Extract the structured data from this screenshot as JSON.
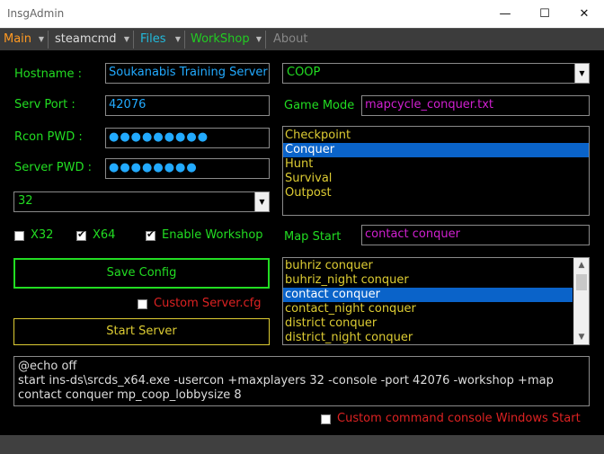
{
  "window": {
    "title": "InsgAdmin",
    "minimize": "—",
    "maximize": "☐",
    "close": "✕"
  },
  "menu": [
    {
      "label": "Main",
      "color": "#ff9922",
      "arrow": true
    },
    {
      "label": "steamcmd",
      "color": "#dddddd",
      "arrow": true
    },
    {
      "label": "Files",
      "color": "#22bbdd",
      "arrow": true
    },
    {
      "label": "WorkShop",
      "color": "#22cc22",
      "arrow": true
    },
    {
      "label": "About",
      "color": "#888888",
      "arrow": false
    }
  ],
  "labels": {
    "hostname": "Hostname :",
    "serv_port": "Serv Port :",
    "rcon_pwd": "Rcon PWD :",
    "server_pwd": "Server PWD :",
    "game_mode": "Game Mode",
    "map_start": "Map Start"
  },
  "fields": {
    "hostname": "Soukanabis Training Server",
    "serv_port": "42076",
    "rcon_pwd": "●●●●●●●●●",
    "server_pwd": "●●●●●●●●",
    "mapcycle": "mapcycle_conquer.txt",
    "map_start": "contact conquer"
  },
  "combos": {
    "game_type": "COOP",
    "max_players": "32"
  },
  "game_modes": [
    "Checkpoint",
    "Conquer",
    "Hunt",
    "Survival",
    "Outpost"
  ],
  "game_mode_selected": "Conquer",
  "maps": [
    "buhriz conquer",
    "buhriz_night conquer",
    "contact conquer",
    "contact_night conquer",
    "district conquer",
    "district_night conquer"
  ],
  "map_selected": "contact conquer",
  "checkboxes": {
    "x32": {
      "label": "X32",
      "checked": false
    },
    "x64": {
      "label": "X64",
      "checked": true
    },
    "enable_workshop": {
      "label": "Enable Workshop",
      "checked": true
    },
    "custom_server_cfg": {
      "label": "Custom Server.cfg",
      "checked": false
    },
    "custom_console": {
      "label": "Custom command console Windows Start",
      "checked": false
    }
  },
  "buttons": {
    "save_config": "Save Config",
    "start_server": "Start Server"
  },
  "console_text": "@echo off\nstart ins-ds\\srcds_x64.exe -usercon +maxplayers 32 -console -port 42076 -workshop +map contact conquer mp_coop_lobbysize 8",
  "colors": {
    "label_green": "#22dd22",
    "cyan_text": "#22aaff",
    "magenta_text": "#d020d0",
    "list_yellow": "#ddcc33",
    "selection_blue": "#0a63c9",
    "red_text": "#dd2222"
  }
}
